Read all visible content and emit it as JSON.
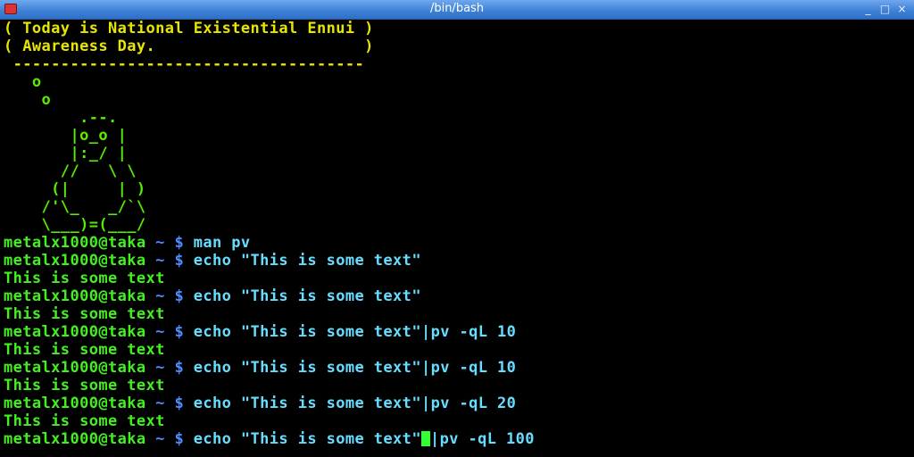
{
  "window": {
    "title": "/bin/bash",
    "controls": {
      "minimize": "_",
      "maximize": "□",
      "close": "×"
    }
  },
  "cowsay": {
    "bubble_line_1": "( Today is National Existential Ennui )",
    "bubble_line_2": "( Awareness Day.                      )",
    "bubble_bottom": " -------------------------------------",
    "art": [
      "   o",
      "    o",
      "        .--.",
      "       |o_o |",
      "       |:_/ |",
      "      //   \\ \\",
      "     (|     | )",
      "    /'\\_   _/`\\",
      "    \\___)=(___/"
    ]
  },
  "prompt": {
    "user": "metalx1000@taka",
    "dir": " ~ ",
    "symbol": "$"
  },
  "history": [
    {
      "command": " man pv",
      "output": null
    },
    {
      "command": " echo \"This is some text\"",
      "output": "This is some text"
    },
    {
      "command": " echo \"This is some text\"",
      "output": "This is some text"
    },
    {
      "command": " echo \"This is some text\"|pv -qL 10",
      "output": "This is some text"
    },
    {
      "command": " echo \"This is some text\"|pv -qL 10",
      "output": "This is some text"
    },
    {
      "command": " echo \"This is some text\"|pv -qL 20",
      "output": "This is some text"
    }
  ],
  "current": {
    "before_cursor": " echo \"This is some text\"",
    "after_cursor": "|pv -qL 100"
  },
  "colors": {
    "background": "#000000",
    "text_green": "#44ee22",
    "bubble_yellow": "#e6e600",
    "prompt_blue": "#4f8cff",
    "titlebar_blue": "#3c7fd6"
  }
}
